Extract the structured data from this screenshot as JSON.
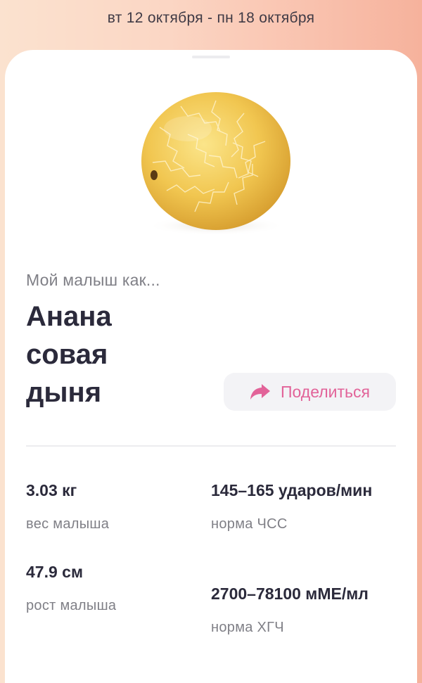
{
  "header": {
    "date_range": "вт 12 октября - пн 18 октября"
  },
  "card": {
    "image": {
      "icon": "melon-illustration"
    },
    "lead": "Мой малыш как...",
    "fruit_name": "Анана совая дыня",
    "share": {
      "icon": "share-arrow-icon",
      "label": "Поделиться"
    },
    "stats": {
      "weight": {
        "value": "3.03 кг",
        "label": "вес малыша"
      },
      "height": {
        "value": "47.9 см",
        "label": "рост малыша"
      },
      "heart_rate": {
        "value": "145–165 ударов/мин",
        "label": "норма ЧСС"
      },
      "hcg": {
        "value": "2700–78100 мМЕ/мл",
        "label": "норма ХГЧ"
      }
    }
  },
  "colors": {
    "accent": "#e26399",
    "title": "#2b2a3b",
    "muted": "#7f7f86",
    "melon": "#f0c24a"
  }
}
